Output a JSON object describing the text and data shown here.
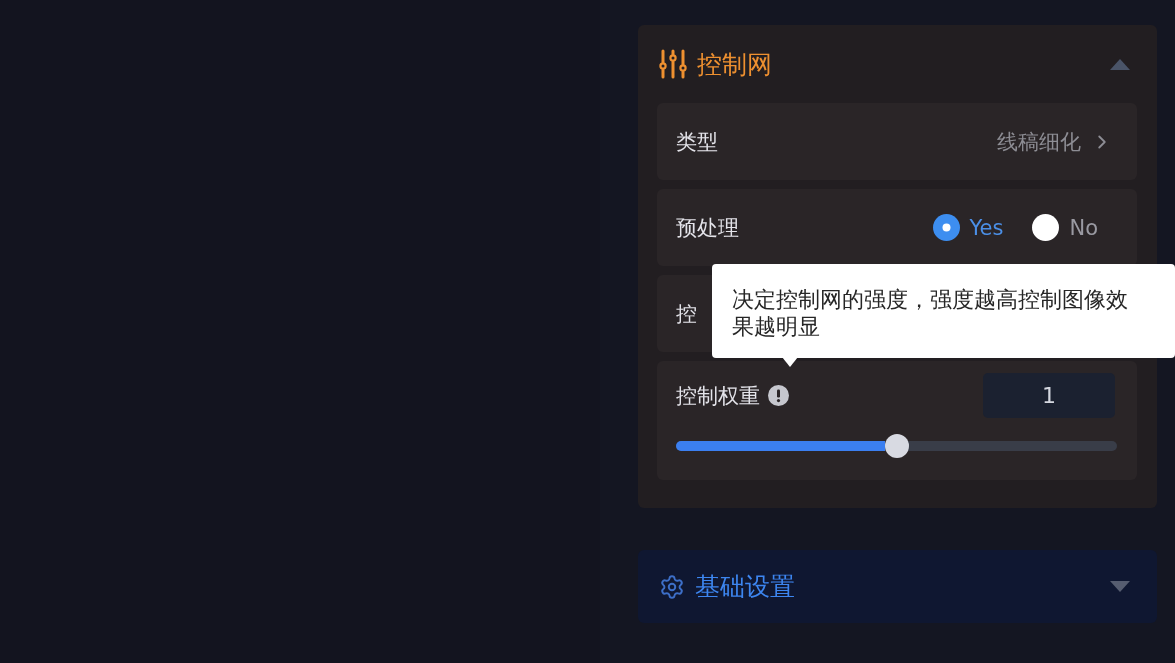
{
  "panels": [
    {
      "title": "控制网",
      "expanded": true,
      "rows": [
        {
          "kind": "select",
          "label": "类型",
          "value": "线稿细化"
        },
        {
          "kind": "radio",
          "label": "预处理",
          "options": [
            {
              "label": "Yes",
              "selected": true
            },
            {
              "label": "No",
              "selected": false
            }
          ]
        },
        {
          "kind": "plain",
          "label": "控"
        },
        {
          "kind": "slider",
          "label": "控制权重",
          "value": "1",
          "level": 0.5,
          "tooltip": "决定控制网的强度，强度越高控制图像效果越明显"
        }
      ]
    },
    {
      "title": "基础设置",
      "expanded": false
    }
  ]
}
